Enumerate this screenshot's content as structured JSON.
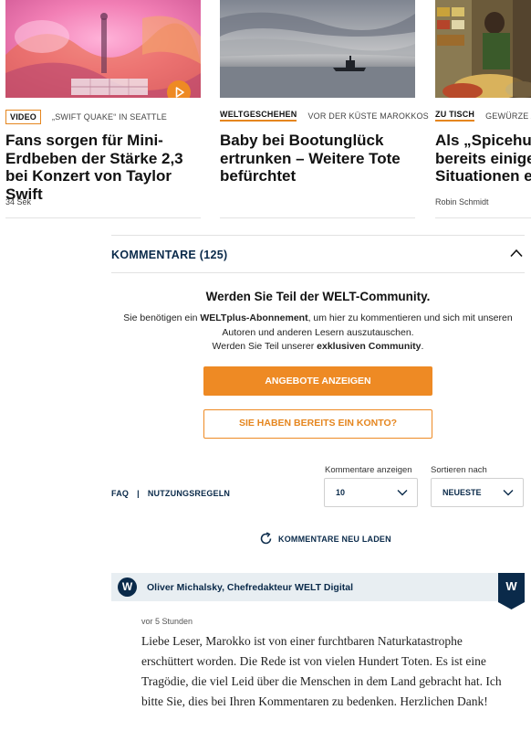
{
  "cards": [
    {
      "tag": "VIDEO",
      "subtag": "„SWIFT QUAKE“ IN SEATTLE",
      "headline": "Fans sorgen für Mini-Erdbeben der Stärke 2,3 bei Konzert von Taylor Swift",
      "byline": "34 Sek",
      "has_play_icon": true
    },
    {
      "tag": "WELTGESCHEHEN",
      "subtag": "VOR DER KÜSTE MAROKKOS",
      "headline": "Baby bei Bootunglück ertrunken – Weitere Tote befürchtet",
      "byline": ""
    },
    {
      "tag": "ZU TISCH",
      "subtag": "GEWÜRZE AU",
      "headline": "Als „Spicehun bereits einige Situationen er",
      "byline": "Robin Schmidt"
    }
  ],
  "comments": {
    "header": "KOMMENTARE (125)",
    "header_icon": "chevron-up-icon",
    "promo_title": "Werden Sie Teil der WELT-Community.",
    "promo_text": {
      "part1": "Sie benötigen ein ",
      "bold1": "WELTplus-Abonnement",
      "part2": ", um hier zu kommentieren und sich mit unseren Autoren und anderen Lesern auszutauschen.",
      "part3": "Werden Sie Teil unserer ",
      "bold2": "exklusiven Community",
      "part4": "."
    },
    "primary_button": "ANGEBOTE ANZEIGEN",
    "secondary_button": "SIE HABEN BEREITS EIN KONTO?",
    "links": {
      "faq": "FAQ",
      "separator": "|",
      "rules": "NUTZUNGSREGELN"
    },
    "count_label": "Kommentare anzeigen",
    "count_value": "10",
    "sort_label": "Sortieren nach",
    "sort_value": "NEUESTE",
    "reload": "KOMMENTARE NEU LADEN",
    "pinned": {
      "avatar_letter": "W",
      "author": "Oliver Michalsky, Chefredakteur WELT Digital",
      "badge_letter": "W",
      "time": "vor 5 Stunden",
      "text": "Liebe Leser, Marokko ist von einer furchtbaren Naturkatastrophe erschüttert worden. Die Rede ist von vielen Hundert Toten. Es ist eine Tragödie, die viel Leid über die Menschen in dem Land gebracht hat. Ich bitte Sie, dies bei Ihren Kommentaren zu bedenken. Herzlichen Dank!"
    }
  },
  "colors": {
    "accent": "#ee8a24",
    "navy": "#0a2a4a",
    "pinned_bg": "#e8eef2"
  }
}
